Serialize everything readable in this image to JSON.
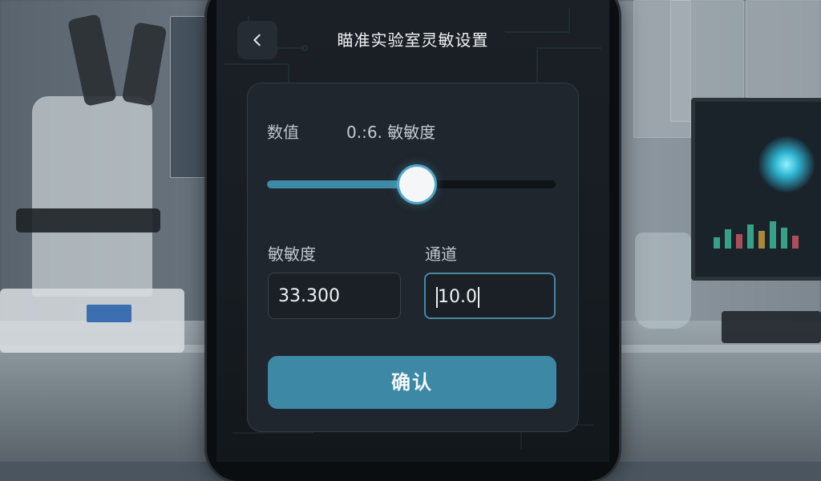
{
  "header": {
    "back_icon": "chevron-left-icon",
    "title": "瞄准实验室灵敏设置"
  },
  "readout": {
    "label": "数值",
    "value": "0.:6. 敏敏度"
  },
  "slider": {
    "value_fraction": 0.52,
    "track_color": "#0f1418",
    "fill_color": "#3d8aa6"
  },
  "fields": {
    "sensitivity": {
      "label": "敏敏度",
      "value": "33.300"
    },
    "channel": {
      "label": "通道",
      "value": "10.0"
    }
  },
  "confirm_button": {
    "label": "确认"
  },
  "colors": {
    "accent": "#3c88a5",
    "card_bg": "#1f262d",
    "screen_bg": "#161c21"
  }
}
